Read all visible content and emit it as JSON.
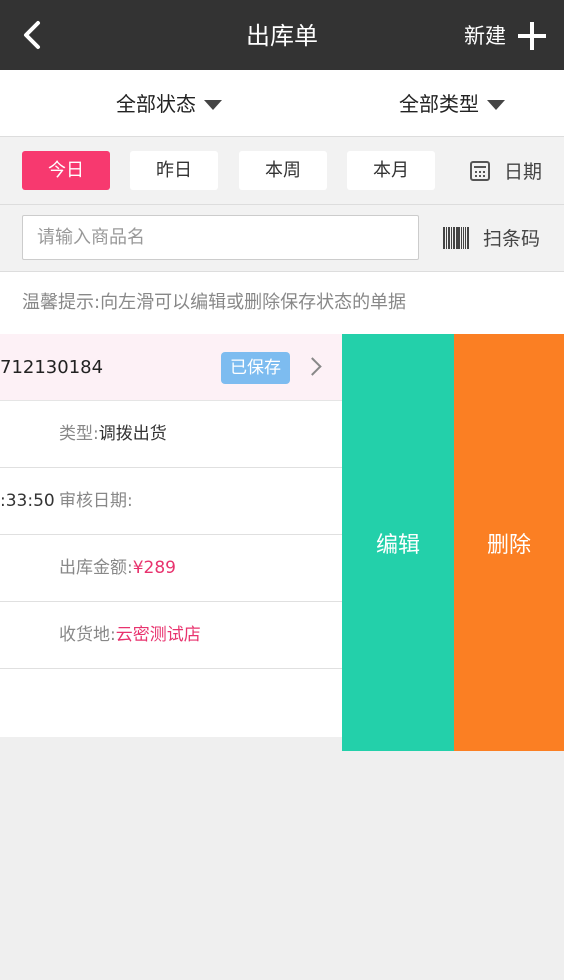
{
  "header": {
    "title": "出库单",
    "new_label": "新建"
  },
  "filters": {
    "status": "全部状态",
    "type": "全部类型"
  },
  "date_tabs": [
    {
      "label": "今日",
      "active": true
    },
    {
      "label": "昨日",
      "active": false
    },
    {
      "label": "本周",
      "active": false
    },
    {
      "label": "本月",
      "active": false
    }
  ],
  "date_picker_label": "日期",
  "search": {
    "placeholder": "请输入商品名",
    "scan_label": "扫条码"
  },
  "tip": "温馨提示:向左滑可以编辑或删除保存状态的单据",
  "order": {
    "number_visible": "712130184",
    "status": "已保存",
    "type_label": "类型:",
    "type_value": "调拨出货",
    "time_visible": ":33:50",
    "audit_label": "审核日期:",
    "amount_label": "出库金额:",
    "amount_value": "¥289",
    "receiver_label": "收货地:",
    "receiver_value": "云密测试店"
  },
  "actions": {
    "edit": "编辑",
    "delete": "删除"
  },
  "colors": {
    "header_bg": "#333333",
    "active_tab": "#f7396f",
    "badge": "#7dbcf0",
    "edit": "#23d0aa",
    "delete": "#fb7f23",
    "accent_text": "#e8336e"
  }
}
